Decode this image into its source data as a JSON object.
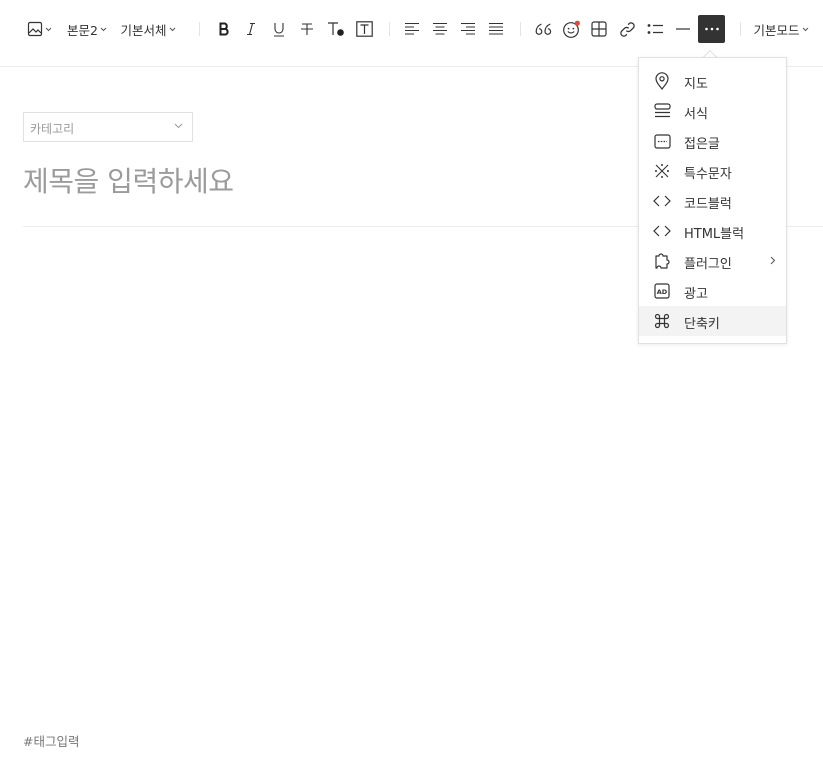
{
  "toolbar": {
    "body_style": "본문2",
    "font_family": "기본서체",
    "mode": "기본모드",
    "more_label": "···",
    "accent_dot_color": "#e8473f"
  },
  "menu": {
    "items": [
      {
        "label": "지도",
        "icon": "map-pin-icon"
      },
      {
        "label": "서식",
        "icon": "template-icon"
      },
      {
        "label": "접은글",
        "icon": "fold-icon"
      },
      {
        "label": "특수문자",
        "icon": "special-char-icon"
      },
      {
        "label": "코드블럭",
        "icon": "code-icon"
      },
      {
        "label": "HTML블럭",
        "icon": "code-icon"
      },
      {
        "label": "플러그인",
        "icon": "plugin-icon",
        "has_submenu": true
      },
      {
        "label": "광고",
        "icon": "ad-icon"
      },
      {
        "label": "단축키",
        "icon": "command-icon",
        "active": true
      }
    ]
  },
  "editor": {
    "category_placeholder": "카테고리",
    "title_placeholder": "제목을 입력하세요",
    "tag_placeholder": "#태그입력"
  }
}
